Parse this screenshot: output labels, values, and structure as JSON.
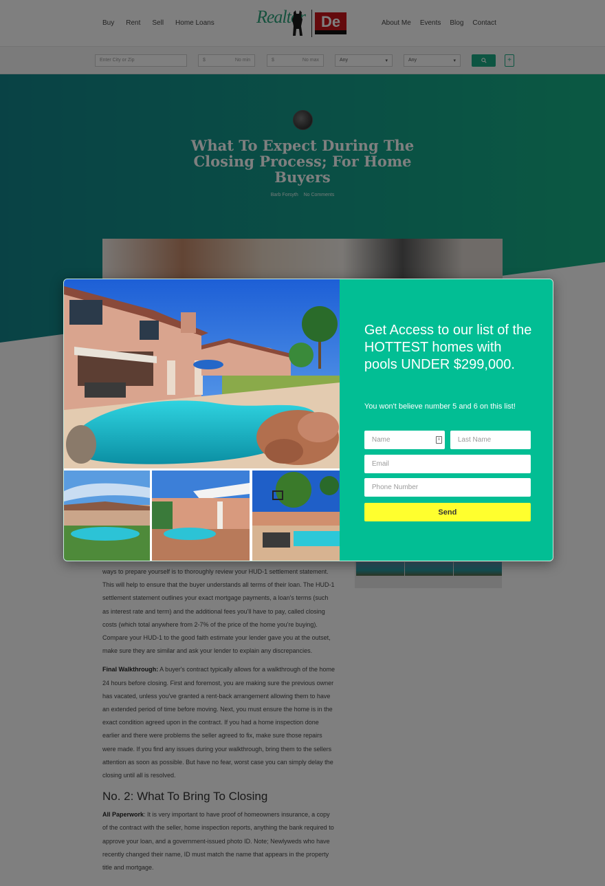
{
  "header": {
    "nav_left": [
      "Buy",
      "Rent",
      "Sell",
      "Home Loans"
    ],
    "nav_right": [
      "About Me",
      "Events",
      "Blog",
      "Contact"
    ],
    "logo_realtor": "Realtor",
    "logo_de": "De"
  },
  "search": {
    "city_placeholder": "Enter City or Zip",
    "min_currency": "$",
    "min_label": "No min",
    "max_currency": "$",
    "max_label": "No max",
    "beds_value": "Any",
    "baths_value": "Any",
    "caret": "▾",
    "search_icon": "search-icon",
    "plus": "+"
  },
  "post": {
    "title": "What To Expect During The Closing Process; For Home Buyers",
    "author": "Barb Forsyth",
    "comments": "No Comments"
  },
  "article": {
    "p1": "ways to prepare yourself is to thoroughly review your HUD-1 settlement statement. This will help to ensure that the buyer understands all terms of their loan. The HUD-1 settlement statement outlines your exact mortgage payments, a loan's terms (such as interest rate and term) and the additional fees you'll have to pay, called closing costs (which total anywhere from 2-7% of the price of the home you're buying). Compare your HUD-1 to the good faith estimate your lender gave you at the outset, make sure they are similar and ask your lender to explain any discrepancies.",
    "p2_bold": "Final Walkthrough:",
    "p2": " A buyer's contract typically allows for a walkthrough of the home 24 hours before closing. First and foremost, you are making sure the previous owner has vacated, unless you've granted a rent-back arrangement allowing them to have an extended period of time before moving. Next, you must ensure the home is in the exact condition agreed upon in the contract. If you had a home inspection done earlier and there were problems the seller agreed to fix, make sure those repairs were made. If you find any issues during your walkthrough, bring them to the sellers attention as soon as possible. But have no fear, worst case you can simply delay the closing until all is resolved.",
    "h2": "No. 2: What To Bring To Closing",
    "p3_bold": "All Paperwork",
    "p3": ": It is very important to have proof of homeowners insurance, a copy of the contract with the seller, home inspection reports, anything the bank required to approve your loan, and a government-issued photo ID. Note; Newlyweds who have recently changed their name, ID must match the name that appears in the property title and mortgage."
  },
  "modal": {
    "headline": "Get Access to our list of the HOTTEST homes with pools UNDER $299,000.",
    "subtext": "You won't believe number 5 and 6 on this list!",
    "name_placeholder": "Name",
    "last_name_placeholder": "Last Name",
    "email_placeholder": "Email",
    "phone_placeholder": "Phone Number",
    "send_label": "Send",
    "colors": {
      "panel": "#02be94",
      "button": "#ffff2e"
    }
  }
}
